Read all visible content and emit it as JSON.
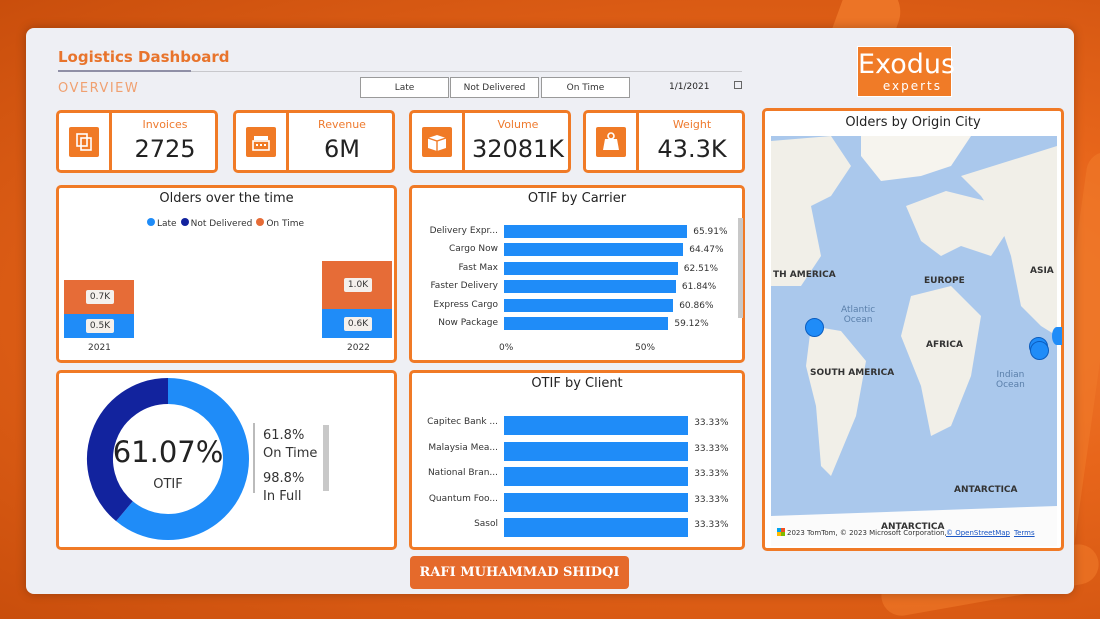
{
  "header": {
    "title": "Logistics Dashboard",
    "subtitle": "OVERVIEW",
    "date": "1/1/2021"
  },
  "slicers": [
    "Late",
    "Not Delivered",
    "On Time"
  ],
  "logo": {
    "main": "Exodus",
    "sub": "experts"
  },
  "kpis": [
    {
      "label": "Invoices",
      "value": "2725",
      "icon": "invoice-icon"
    },
    {
      "label": "Revenue",
      "value": "6M",
      "icon": "cash-register-icon"
    },
    {
      "label": "Volume",
      "value": "32081K",
      "icon": "box-icon"
    },
    {
      "label": "Weight",
      "value": "43.3K",
      "icon": "weight-icon"
    }
  ],
  "colors": {
    "accent": "#f07a26",
    "late": "#1f8cf8",
    "not_delivered": "#12239e",
    "on_time": "#e66c37"
  },
  "chart_data": [
    {
      "type": "bar",
      "title": "Olders over the time",
      "categories": [
        "2021",
        "2022"
      ],
      "series": [
        {
          "name": "Late",
          "values": [
            0.5,
            0.6
          ],
          "labels": [
            "0.5K",
            "0.6K"
          ]
        },
        {
          "name": "Not Delivered",
          "values": [
            0,
            0
          ]
        },
        {
          "name": "On Time",
          "values": [
            0.7,
            1.0
          ],
          "labels": [
            "0.7K",
            "1.0K"
          ]
        }
      ],
      "stacked": true,
      "legend": "top"
    },
    {
      "type": "bar",
      "orientation": "horizontal",
      "title": "OTIF by Carrier",
      "categories": [
        "Delivery Expr...",
        "Cargo Now",
        "Fast Max",
        "Faster Delivery",
        "Express Cargo",
        "Now Package"
      ],
      "values": [
        65.91,
        64.47,
        62.51,
        61.84,
        60.86,
        59.12
      ],
      "value_labels": [
        "65.91%",
        "64.47%",
        "62.51%",
        "61.84%",
        "60.86%",
        "59.12%"
      ],
      "xticks": [
        "0%",
        "50%"
      ],
      "xlim": [
        0,
        100
      ]
    },
    {
      "type": "bar",
      "orientation": "horizontal",
      "title": "OTIF by Client",
      "categories": [
        "Capitec Bank ...",
        "Malaysia Mea...",
        "National Bran...",
        "Quantum Foo...",
        "Sasol"
      ],
      "values": [
        33.33,
        33.33,
        33.33,
        33.33,
        33.33
      ],
      "value_labels": [
        "33.33%",
        "33.33%",
        "33.33%",
        "33.33%",
        "33.33%"
      ],
      "xlim": [
        0,
        38
      ]
    },
    {
      "type": "pie",
      "donut": true,
      "center_value": "61.07%",
      "center_label": "OTIF",
      "values": [
        61.07,
        38.93
      ]
    }
  ],
  "otif_side": [
    {
      "value": "61.8%",
      "label": "On Time"
    },
    {
      "value": "98.8%",
      "label": "In Full"
    }
  ],
  "map": {
    "title": "Olders by Origin City",
    "continents": [
      "TH AMERICA",
      "EUROPE",
      "ASIA",
      "AFRICA",
      "SOUTH AMERICA",
      "ANTARCTICA",
      "ANTARCTICA"
    ],
    "oceans": [
      "Atlantic\nOcean",
      "Indian\nOcean"
    ],
    "attribution": "2023 TomTom, © 2023 Microsoft Corporation,",
    "osm": "© OpenStreetMap",
    "terms": "Terms"
  },
  "author": "RAFI MUHAMMAD SHIDQI"
}
